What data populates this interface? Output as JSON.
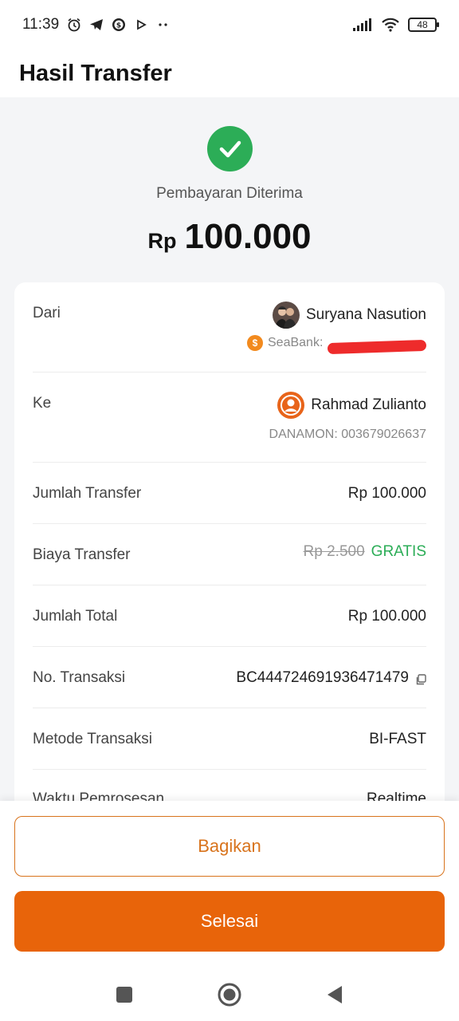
{
  "status_bar": {
    "time": "11:39",
    "battery": "48"
  },
  "header": {
    "title": "Hasil Transfer"
  },
  "result": {
    "status": "Pembayaran Diterima",
    "currency": "Rp",
    "amount": "100.000"
  },
  "details": {
    "from": {
      "label": "Dari",
      "name": "Suryana Nasution",
      "bank": "SeaBank:"
    },
    "to": {
      "label": "Ke",
      "name": "Rahmad Zulianto",
      "bank": "DANAMON: 003679026637"
    },
    "transfer_amount": {
      "label": "Jumlah Transfer",
      "value": "Rp 100.000"
    },
    "fee": {
      "label": "Biaya Transfer",
      "original": "Rp 2.500",
      "value": "GRATIS"
    },
    "total": {
      "label": "Jumlah Total",
      "value": "Rp 100.000"
    },
    "transaction_no": {
      "label": "No. Transaksi",
      "value": "BC444724691936471479"
    },
    "method": {
      "label": "Metode Transaksi",
      "value": "BI-FAST"
    },
    "processing_time": {
      "label": "Waktu Pemrosesan",
      "value": "Realtime"
    }
  },
  "actions": {
    "share": "Bagikan",
    "done": "Selesai"
  },
  "colors": {
    "accent": "#e8640a",
    "success": "#2cad57"
  }
}
